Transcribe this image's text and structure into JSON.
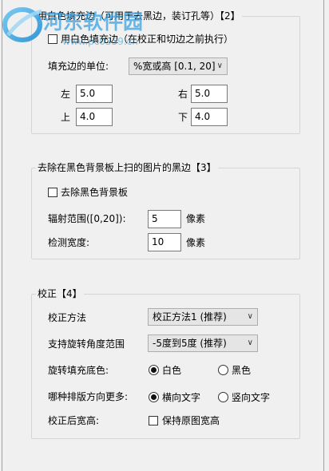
{
  "watermark": {
    "site_name": "河东软件园",
    "url": "www.pc0359.cn"
  },
  "section_fill": {
    "title": "用白色填充边（可用于去黑边，装订孔等）【2】",
    "checkbox_label": "用白色填充边（在校正和切边之前执行）",
    "unit_label": "填充边的单位:",
    "unit_value": "%宽或高 [0.1, 20]",
    "left_label": "左",
    "left_value": "5.0",
    "right_label": "右",
    "right_value": "5.0",
    "top_label": "上",
    "top_value": "4.0",
    "bottom_label": "下",
    "bottom_value": "4.0"
  },
  "section_black": {
    "title": "去除在黑色背景板上扫的图片的黑边【3】",
    "checkbox_label": "去除黑色背景板",
    "range_label": "辐射范围([0,20]):",
    "range_value": "5",
    "range_unit": "像素",
    "width_label": "检测宽度:",
    "width_value": "10",
    "width_unit": "像素"
  },
  "section_correct": {
    "title": "校正【4】",
    "method_label": "校正方法",
    "method_value": "校正方法1 (推荐)",
    "angle_label": "支持旋转角度范围",
    "angle_value": "-5度到5度 (推荐)",
    "fill_label": "旋转填充底色:",
    "fill_white": "白色",
    "fill_black": "黑色",
    "direction_label": "哪种排版方向更多:",
    "direction_horizontal": "横向文字",
    "direction_vertical": "竖向文字",
    "keep_label": "校正后宽高:",
    "keep_checkbox": "保持原图宽高"
  }
}
